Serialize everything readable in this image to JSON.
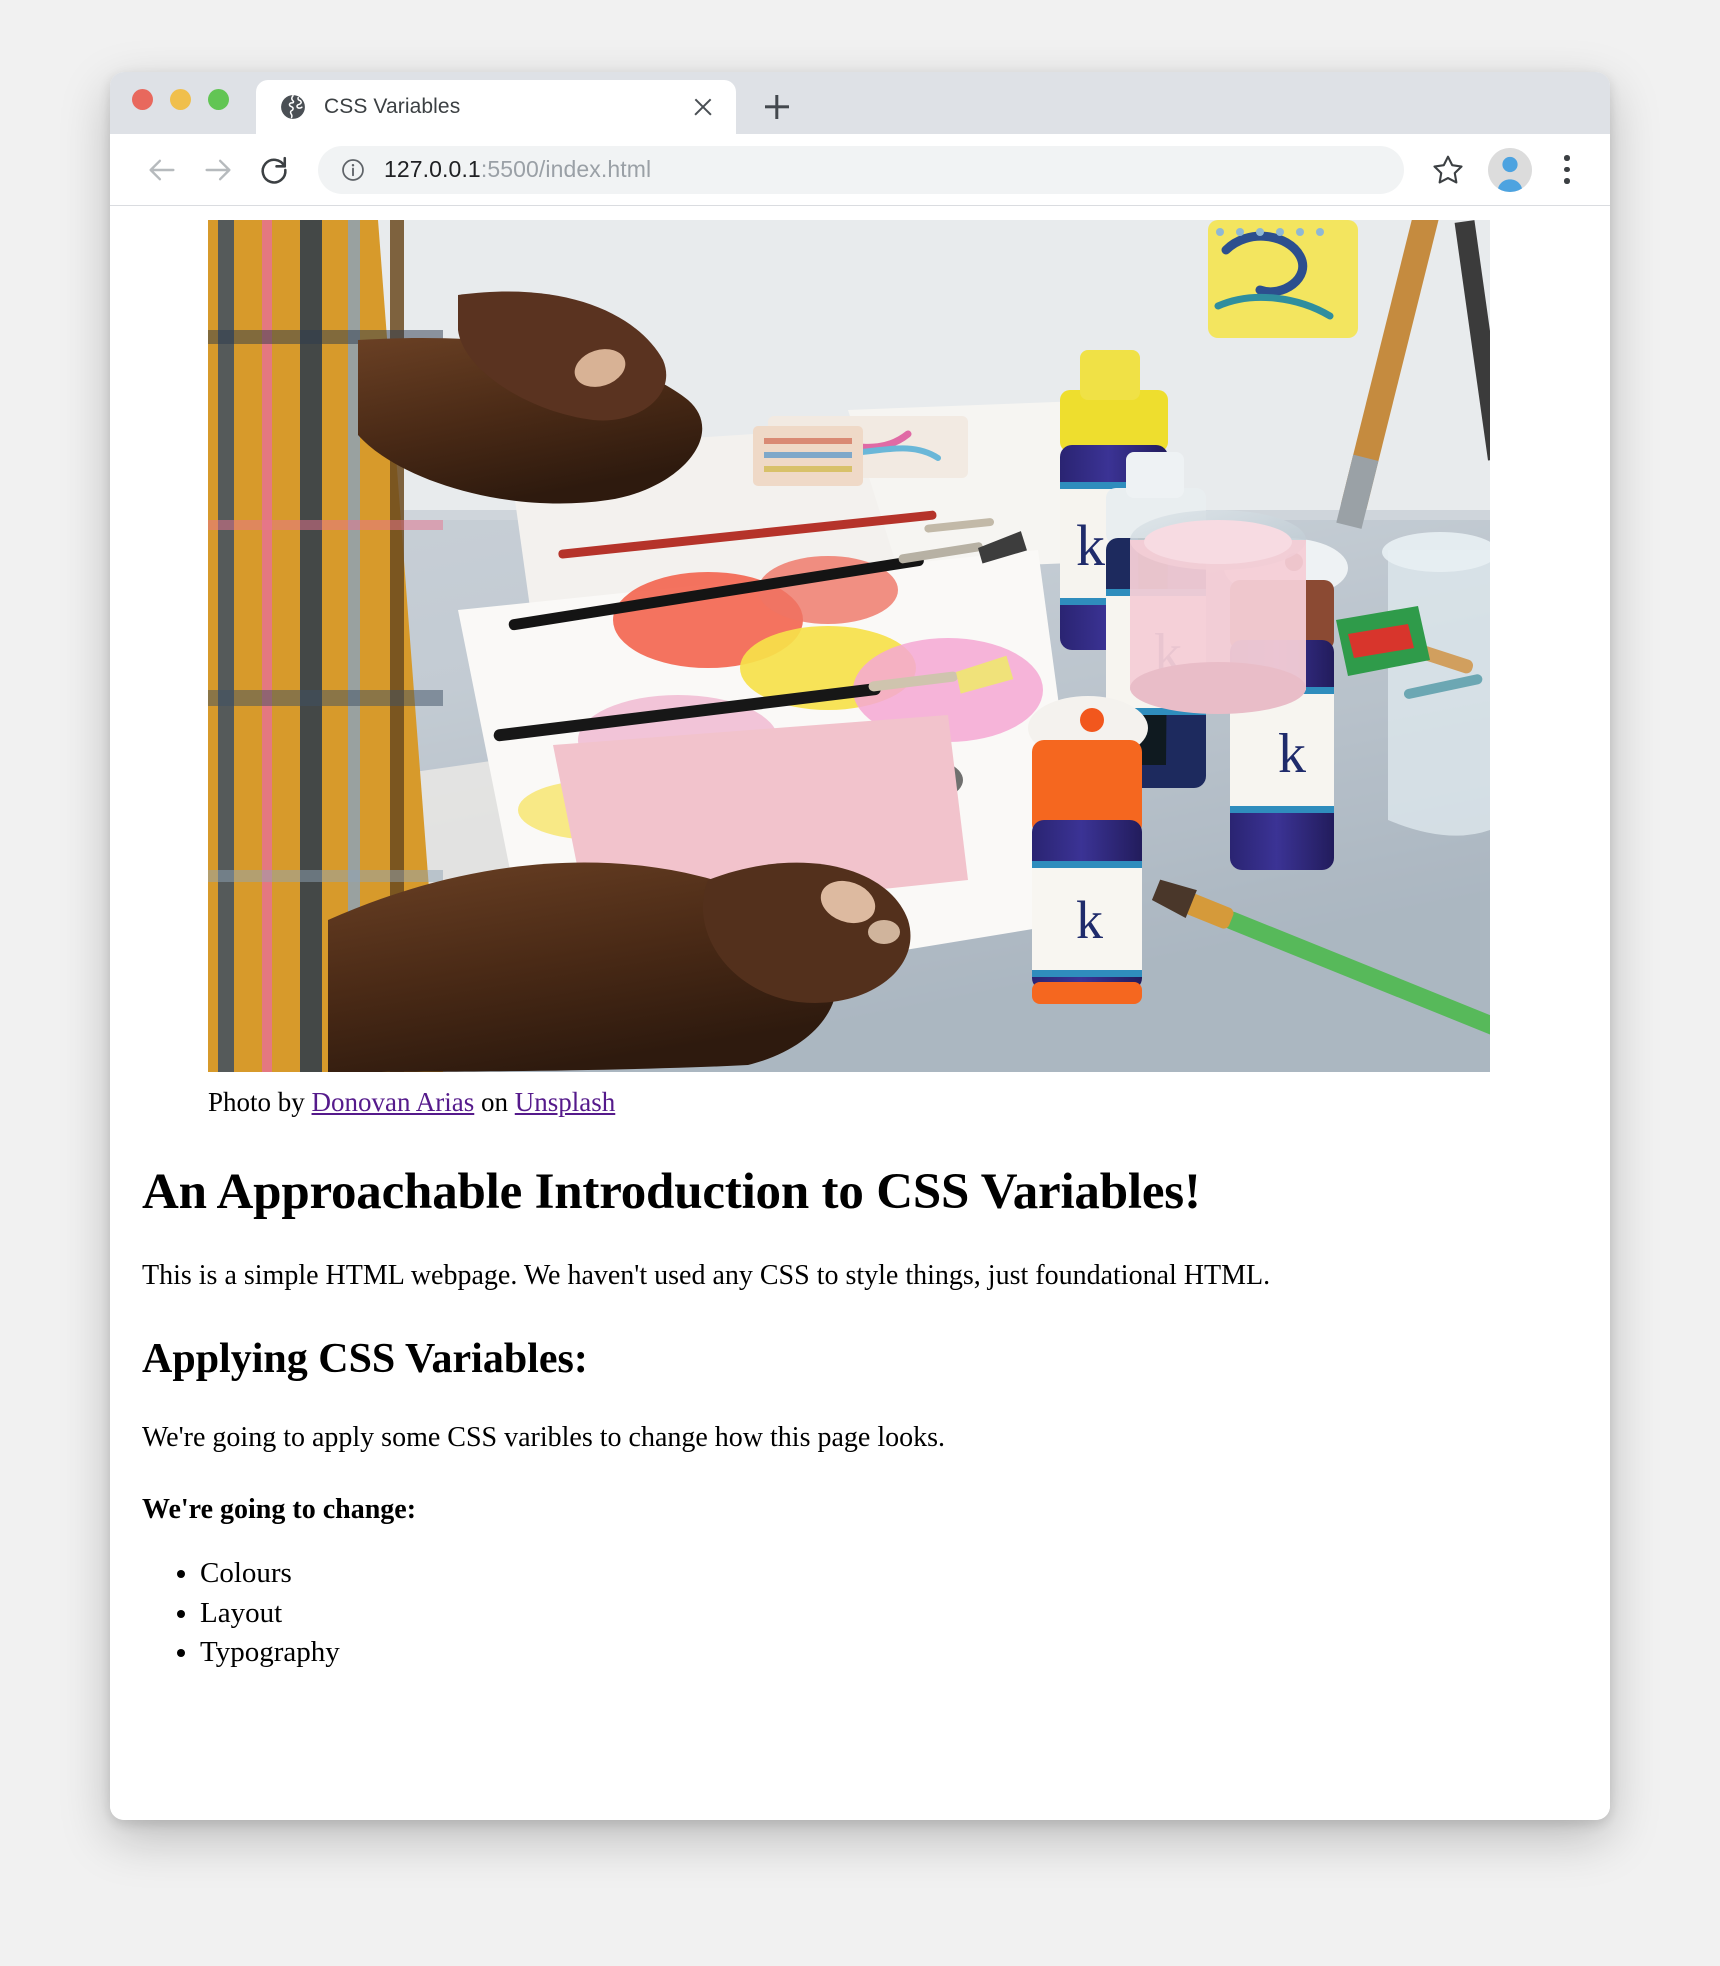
{
  "window": {
    "traffic_lights": [
      {
        "name": "close",
        "color": "#e8685d"
      },
      {
        "name": "minimize",
        "color": "#f0bf4c"
      },
      {
        "name": "maximize",
        "color": "#62c554"
      }
    ]
  },
  "tabstrip": {
    "tabs": [
      {
        "title": "CSS Variables",
        "favicon": "globe-icon",
        "close_label": "×",
        "active": true
      }
    ],
    "new_tab_label": "+"
  },
  "toolbar": {
    "back_icon": "arrow-left-icon",
    "forward_icon": "arrow-right-icon",
    "reload_icon": "reload-icon",
    "info_icon": "info-circle-icon",
    "url_host": "127.0.0.1",
    "url_rest": ":5500/index.html",
    "url_full": "127.0.0.1:5500/index.html",
    "bookmark_icon": "star-icon",
    "profile_icon": "avatar-icon",
    "menu_icon": "three-dots-vertical-icon"
  },
  "page": {
    "title": "CSS Variables",
    "photo": {
      "alt": "person painting with acrylic paint bottles and brushes on a white table",
      "caption_prefix": "Photo by ",
      "author_link": "Donovan Arias",
      "caption_middle": " on ",
      "source_link": "Unsplash",
      "link_color": "#551a8b"
    },
    "heading1": "An Approachable Introduction to CSS Variables!",
    "paragraph1": "This is a simple HTML webpage. We haven't used any CSS to style things, just foundational HTML.",
    "heading2": "Applying CSS Variables:",
    "paragraph2": "We're going to apply some CSS varibles to change how this page looks.",
    "strong_line": "We're going to change:",
    "list": [
      "Colours",
      "Layout",
      "Typography"
    ]
  }
}
